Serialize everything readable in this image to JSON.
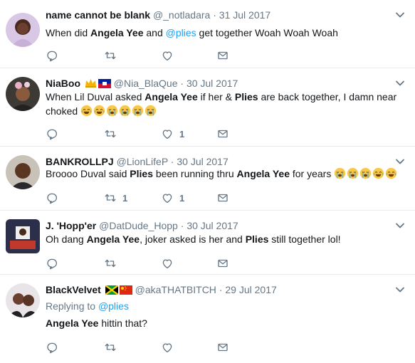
{
  "tweets": [
    {
      "name": "name cannot be blank",
      "handle": "@_notladara",
      "sep": "·",
      "date": "31 Jul 2017",
      "text": {
        "a": "When did ",
        "b": "Angela Yee",
        "c": " and ",
        "d": "@plies",
        "e": " get together Woah Woah Woah"
      },
      "actions": {
        "reply_count": "",
        "retweet_count": "",
        "like_count": ""
      }
    },
    {
      "name": "NiaBoo",
      "handle": "@Nia_BlaQue",
      "sep": "·",
      "date": "30 Jul 2017",
      "text": {
        "a": "When Lil Duval asked ",
        "b": "Angela Yee",
        "c": " if her & ",
        "d": "Plies",
        "e": " are back together, I damn near",
        "f": "choked"
      },
      "actions": {
        "reply_count": "",
        "retweet_count": "",
        "like_count": "1"
      }
    },
    {
      "name": "BANKROLLPJ",
      "handle": "@LionLifeP",
      "sep": "·",
      "date": "30 Jul 2017",
      "text": {
        "a": "Broooo Duval said ",
        "b": "Plies",
        "c": " been running thru ",
        "d": "Angela Yee",
        "e": " for years"
      },
      "actions": {
        "reply_count": "",
        "retweet_count": "1",
        "like_count": "1"
      }
    },
    {
      "name": "J. 'Hopp'er",
      "handle": "@DatDude_Hopp",
      "sep": "·",
      "date": "30 Jul 2017",
      "text": {
        "a": "Oh dang ",
        "b": "Angela Yee",
        "c": ", joker asked is her and ",
        "d": "Plies",
        "e": " still together lol!"
      },
      "actions": {
        "reply_count": "",
        "retweet_count": "",
        "like_count": ""
      }
    },
    {
      "name": "BlackVelvet",
      "handle": "@akaTHATBITCH",
      "sep": "·",
      "date": "29 Jul 2017",
      "replying_label": "Replying to",
      "replying_handle": "@plies",
      "text": {
        "a": "Angela Yee",
        "b": " hittin that?"
      },
      "actions": {
        "reply_count": "",
        "retweet_count": "",
        "like_count": ""
      }
    }
  ],
  "colors": {
    "link": "#1da1f2",
    "meta": "#657786",
    "icon": "#657786",
    "divider": "#e6ecf0"
  },
  "icons": [
    "reply-icon",
    "retweet-icon",
    "like-icon",
    "message-icon",
    "chevron-down-icon",
    "crown-emoji",
    "flag-haiti",
    "flag-jamaica",
    "flag-china",
    "tears-of-joy-emoji",
    "crying-emoji"
  ]
}
